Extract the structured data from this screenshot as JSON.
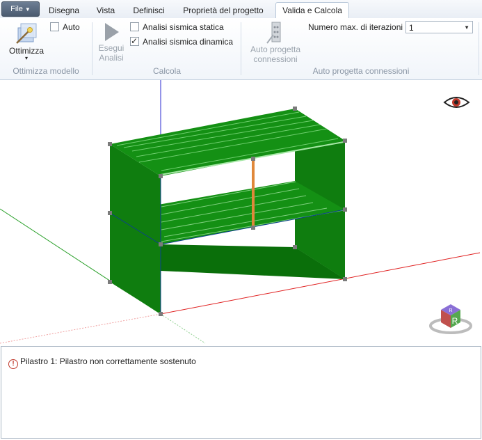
{
  "file_tab": {
    "label": "File"
  },
  "tabs": [
    {
      "label": "Disegna"
    },
    {
      "label": "Vista"
    },
    {
      "label": "Definisci"
    },
    {
      "label": "Proprietà del progetto"
    },
    {
      "label": "Valida e Calcola"
    }
  ],
  "active_tab": "Valida e Calcola",
  "ribbon": {
    "ottimizza_label": "Ottimizza",
    "auto_label": "Auto",
    "group_ottimizza": "Ottimizza modello",
    "esegui_label_1": "Esegui",
    "esegui_label_2": "Analisi",
    "statica_label": "Analisi sismica statica",
    "statica_checked": false,
    "dinamica_label": "Analisi sismica dinamica",
    "dinamica_checked": true,
    "group_calcola": "Calcola",
    "auto_progetta_label_1": "Auto progetta",
    "auto_progetta_label_2": "connessioni",
    "iter_label": "Numero max. di iterazioni",
    "iter_value": "1",
    "group_connessioni": "Auto progetta connessioni"
  },
  "view_cube": {
    "face_front": "R",
    "face_top": "R"
  },
  "messages": [
    {
      "text": "Pilastro 1: Pilastro non correttamente sostenuto",
      "level": "error"
    }
  ],
  "colors": {
    "wall_green": "#0f7d0f",
    "slab_green": "#149014",
    "column_orange": "#e0883a",
    "axis_x": "#e02020",
    "axis_y": "#2aa02a",
    "axis_z": "#2a2ad0"
  }
}
